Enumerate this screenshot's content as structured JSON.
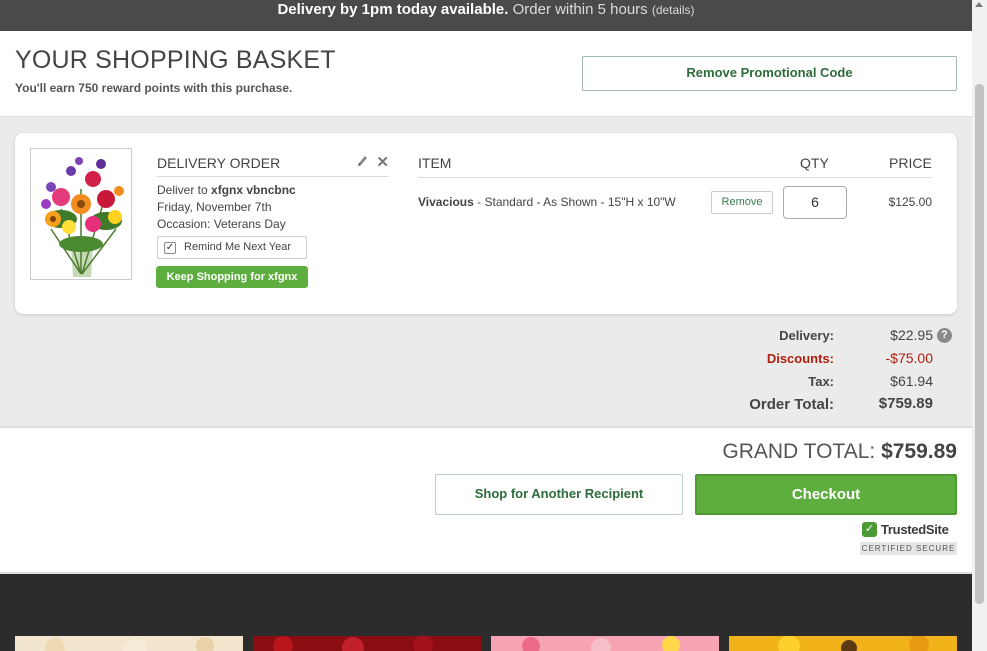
{
  "topbar": {
    "bold": "Delivery by 1pm today available.",
    "light": "Order within 5 hours",
    "small": "(details)"
  },
  "header": {
    "title": "YOUR SHOPPING BASKET",
    "reward": "You'll earn 750 reward points with this purchase.",
    "promo_button": "Remove Promotional Code"
  },
  "delivery": {
    "heading": "DELIVERY ORDER",
    "deliver_to_prefix": "Deliver to ",
    "recipient": "xfgnx vbncbnc",
    "date": "Friday, November 7th",
    "occasion": "Occasion: Veterans Day",
    "remind_label": "Remind Me Next Year",
    "remind_checked": true,
    "keep_shopping": "Keep Shopping for xfgnx"
  },
  "columns": {
    "item": "ITEM",
    "qty": "QTY",
    "price": "PRICE"
  },
  "item": {
    "name": "Vivacious",
    "detail": " - Standard - As Shown - 15\"H x 10\"W",
    "remove_label": "Remove",
    "qty": "6",
    "price": "$125.00"
  },
  "summary": {
    "delivery_label": "Delivery:",
    "delivery_value": "$22.95",
    "discounts_label": "Discounts:",
    "discounts_value": "-$75.00",
    "tax_label": "Tax:",
    "tax_value": "$61.94",
    "total_label": "Order Total:",
    "total_value": "$759.89",
    "help_glyph": "?"
  },
  "footer": {
    "grand_label": "GRAND TOTAL:",
    "grand_value": "$759.89",
    "another_button": "Shop for Another Recipient",
    "checkout_button": "Checkout",
    "trusted_name": "TrustedSite",
    "trusted_sub": "CERTIFIED SECURE"
  },
  "colors": {
    "accent_green": "#5dae3f",
    "discount_red": "#b01e0f",
    "topbar_bg": "#4a4a4a"
  }
}
